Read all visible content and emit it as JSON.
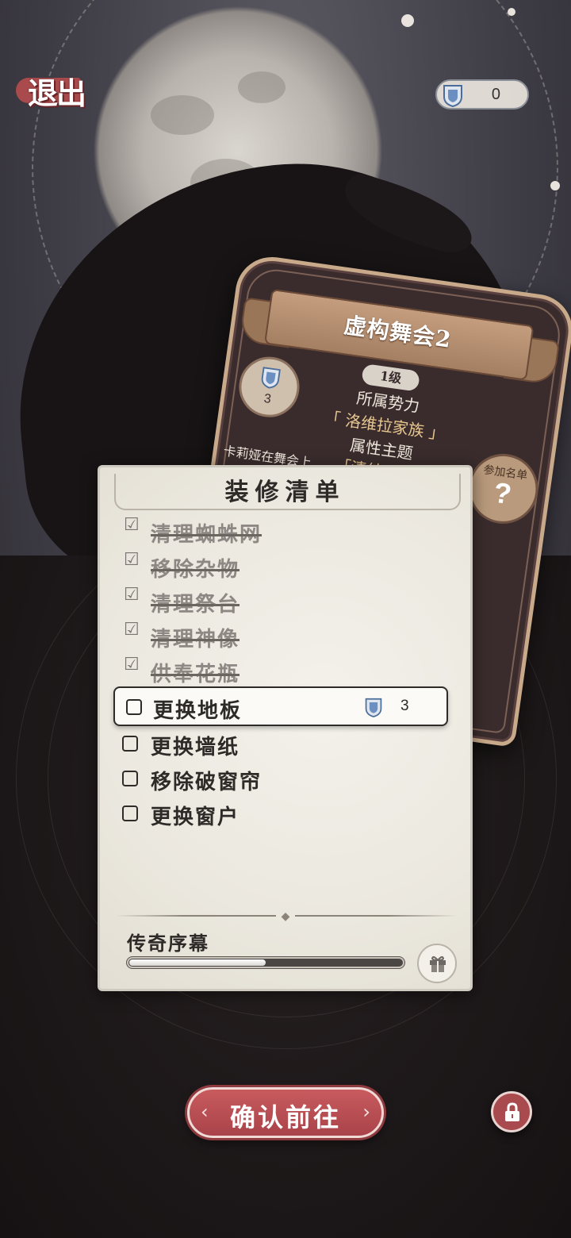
{
  "header": {
    "exit_label": "退出",
    "currency": {
      "icon": "blue-gem-badge-icon",
      "value": "0"
    }
  },
  "character_card": {
    "title": "虚构舞会2",
    "level": "1级",
    "badge": {
      "icon": "blue-gem-badge-icon",
      "value": "3"
    },
    "faction_label": "所属势力",
    "faction_value": "「 洛维拉家族 」",
    "attribute_label": "属性主题",
    "attribute_value": "「清纯」「素雅",
    "join_badge_label": "参加名单",
    "join_badge_icon": "?",
    "description": "卡莉娅在舞会上"
  },
  "checklist": {
    "title": "装修清单",
    "done_check": "☑",
    "tasks_done": [
      "清理蜘蛛网",
      "移除杂物",
      "清理祭台",
      "清理神像",
      "供奉花瓶"
    ],
    "active_task": {
      "label": "更换地板",
      "cost_icon": "blue-gem-badge-icon",
      "cost": "3"
    },
    "tasks_pending": [
      "更换墙纸",
      "移除破窗帘",
      "更换窗户"
    ],
    "ornament": "◆",
    "progress_label": "传奇序幕",
    "progress": 0.5
  },
  "footer": {
    "confirm_label": "确认前往",
    "confirm_arrow_left": "‹",
    "confirm_arrow_right": "›",
    "lock_icon": "lock-icon"
  },
  "colors": {
    "accent_red": "#a9434a",
    "panel_bg": "#ebe8df",
    "text_dark": "#2d2a28",
    "text_done": "#8d8883",
    "card_gold": "#e8c790"
  }
}
